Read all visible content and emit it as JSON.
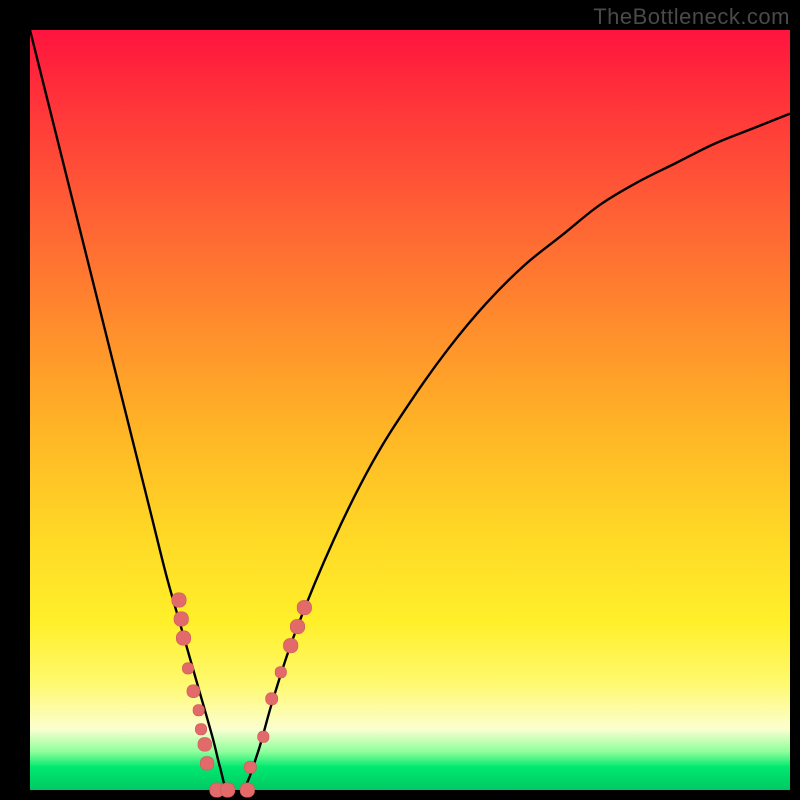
{
  "watermark": "TheBottleneck.com",
  "colors": {
    "frame": "#000000",
    "curve": "#000000",
    "marker_fill": "#e26a6a",
    "marker_stroke": "#d05858"
  },
  "chart_data": {
    "type": "line",
    "title": "",
    "xlabel": "",
    "ylabel": "",
    "xlim": [
      0,
      100
    ],
    "ylim": [
      0,
      100
    ],
    "series": [
      {
        "name": "bottleneck-curve",
        "x": [
          0,
          2,
          4,
          6,
          8,
          10,
          12,
          14,
          16,
          18,
          20,
          22,
          24,
          25,
          26,
          28,
          30,
          32,
          35,
          40,
          45,
          50,
          55,
          60,
          65,
          70,
          75,
          80,
          85,
          90,
          95,
          100
        ],
        "y": [
          100,
          92,
          84,
          76,
          68,
          60,
          52,
          44,
          36,
          28,
          21,
          14,
          7,
          3,
          0,
          0,
          5,
          12,
          21,
          33,
          43,
          51,
          58,
          64,
          69,
          73,
          77,
          80,
          82.5,
          85,
          87,
          89
        ]
      }
    ],
    "markers": [
      {
        "x": 19.6,
        "y": 25.0,
        "size": 1.9
      },
      {
        "x": 19.9,
        "y": 22.5,
        "size": 1.9
      },
      {
        "x": 20.2,
        "y": 20.0,
        "size": 1.9
      },
      {
        "x": 20.8,
        "y": 16.0,
        "size": 1.5
      },
      {
        "x": 21.5,
        "y": 13.0,
        "size": 1.7
      },
      {
        "x": 22.2,
        "y": 10.5,
        "size": 1.5
      },
      {
        "x": 22.5,
        "y": 8.0,
        "size": 1.5
      },
      {
        "x": 23.0,
        "y": 6.0,
        "size": 1.8
      },
      {
        "x": 23.3,
        "y": 3.5,
        "size": 1.8
      },
      {
        "x": 24.6,
        "y": 0.0,
        "size": 1.9
      },
      {
        "x": 26.0,
        "y": 0.0,
        "size": 1.9
      },
      {
        "x": 28.6,
        "y": 0.0,
        "size": 1.9
      },
      {
        "x": 29.0,
        "y": 3.0,
        "size": 1.6
      },
      {
        "x": 30.7,
        "y": 7.0,
        "size": 1.5
      },
      {
        "x": 31.8,
        "y": 12.0,
        "size": 1.6
      },
      {
        "x": 33.0,
        "y": 15.5,
        "size": 1.5
      },
      {
        "x": 34.3,
        "y": 19.0,
        "size": 1.9
      },
      {
        "x": 35.2,
        "y": 21.5,
        "size": 1.9
      },
      {
        "x": 36.1,
        "y": 24.0,
        "size": 1.9
      }
    ]
  }
}
